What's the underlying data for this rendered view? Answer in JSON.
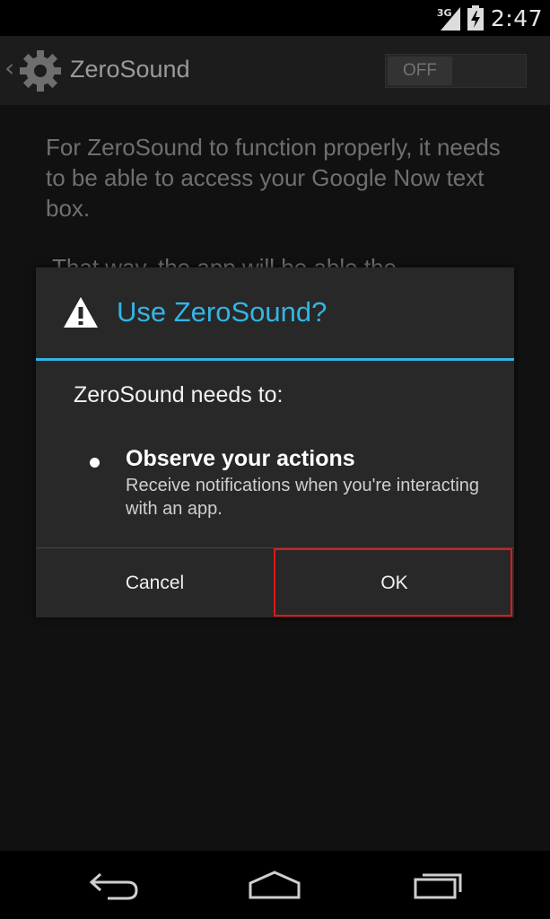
{
  "status_bar": {
    "network_label": "3G",
    "time": "2:47"
  },
  "app_bar": {
    "title": "ZeroSound",
    "toggle_label": "OFF"
  },
  "content": {
    "description": "For ZeroSound to function properly, it needs to be able to access your Google Now text box.",
    "description_partial": "That way, the app will be able the"
  },
  "dialog": {
    "title": "Use ZeroSound?",
    "intro": "ZeroSound needs to:",
    "permission_title": "Observe your actions",
    "permission_description": "Receive notifications when you're interacting with an app.",
    "cancel_label": "Cancel",
    "ok_label": "OK",
    "accent_color": "#33b5e5",
    "highlight_color": "#e01818"
  },
  "nav_bar": {
    "icons": [
      "back-icon",
      "home-icon",
      "recents-icon"
    ]
  }
}
